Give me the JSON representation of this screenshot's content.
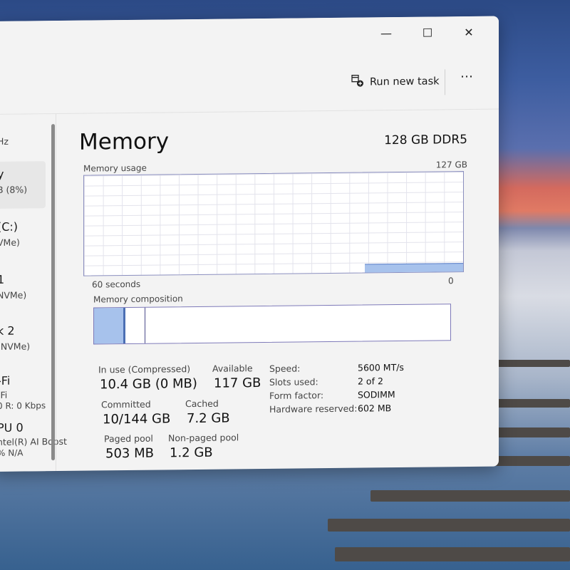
{
  "toolbar": {
    "run_new_task": "Run new task",
    "more": "⋯"
  },
  "window_controls": {
    "minimize": "—",
    "maximize": "☐",
    "close": "✕"
  },
  "sidebar": {
    "items": [
      {
        "title": "",
        "sub": "Hz"
      },
      {
        "title": "y",
        "sub": "B (8%)"
      },
      {
        "title": "(C:)",
        "sub": "VMe)"
      },
      {
        "title": "1",
        "sub": "NVMe)"
      },
      {
        "title": "k 2",
        "sub": "(NVMe)"
      },
      {
        "title": "-Fi",
        "sub": "-Fi",
        "sub2": "0 R: 0 Kbps"
      },
      {
        "title": "PU 0",
        "sub": "ntel(R) AI Boost",
        "sub2": "% N/A"
      }
    ]
  },
  "memory": {
    "title": "Memory",
    "spec": "128 GB DDR5",
    "usage_label": "Memory usage",
    "usage_max": "127 GB",
    "axis_left": "60 seconds",
    "axis_right": "0",
    "usage_fraction": 0.08,
    "composition_label": "Memory composition",
    "composition": {
      "in_use_gb": 10.4,
      "modified_gb": 0.5,
      "standby_gb": 7.2,
      "total_gb": 128
    },
    "stats": {
      "in_use_label": "In use (Compressed)",
      "in_use_value": "10.4 GB (0 MB)",
      "available_label": "Available",
      "available_value": "117 GB",
      "committed_label": "Committed",
      "committed_value": "10/144 GB",
      "cached_label": "Cached",
      "cached_value": "7.2 GB",
      "paged_label": "Paged pool",
      "paged_value": "503 MB",
      "nonpaged_label": "Non-paged pool",
      "nonpaged_value": "1.2 GB"
    },
    "details": [
      {
        "label": "Speed:",
        "value": "5600 MT/s"
      },
      {
        "label": "Slots used:",
        "value": "2 of 2"
      },
      {
        "label": "Form factor:",
        "value": "SODIMM"
      },
      {
        "label": "Hardware reserved:",
        "value": "602 MB"
      }
    ]
  },
  "colors": {
    "graph_fill": "#a7c2ec",
    "graph_border": "#8b8fbf",
    "composition_border": "#7d79b8"
  }
}
